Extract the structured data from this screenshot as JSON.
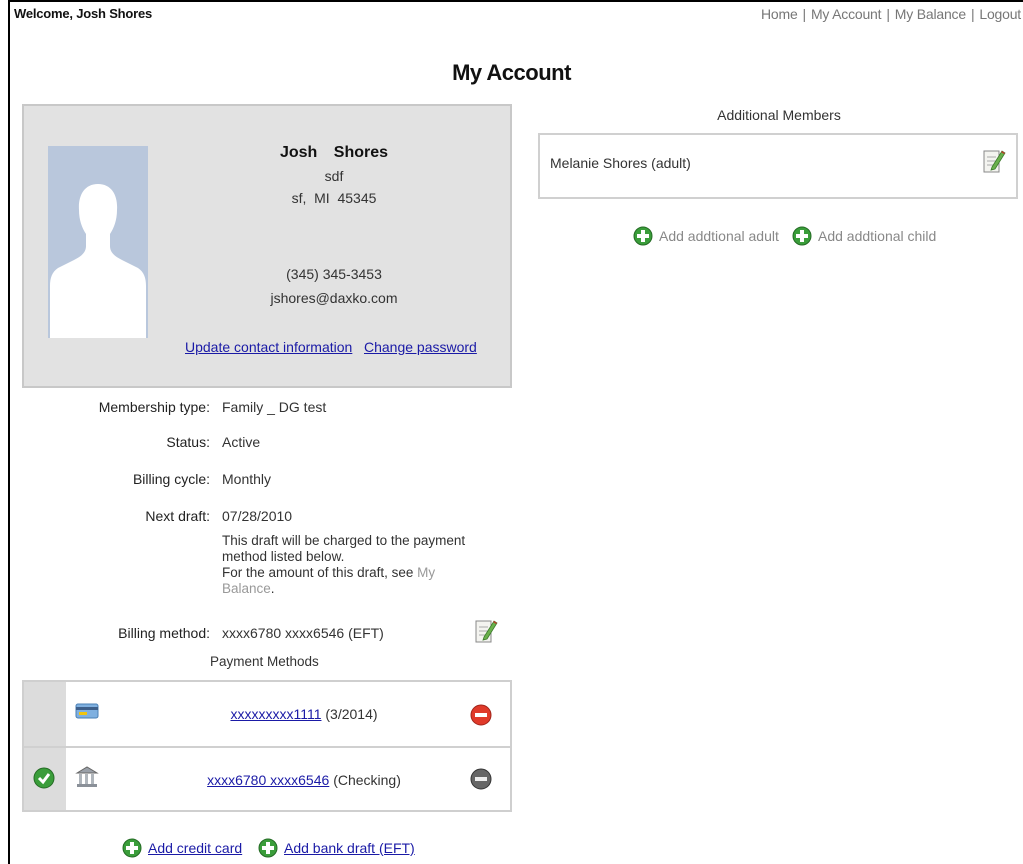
{
  "header": {
    "welcome": "Welcome, Josh Shores",
    "nav": [
      "Home",
      "My Account",
      "My Balance",
      "Logout"
    ]
  },
  "page": {
    "title": "My Account"
  },
  "profile": {
    "first_name": "Josh",
    "last_name": "Shores",
    "name": "Josh Shores",
    "address1": "sdf",
    "city_state_zip": "sf,  MI  45345",
    "phone": "(345) 345-3453",
    "email": "jshores@daxko.com",
    "update_link": "Update contact information",
    "password_link": "Change password"
  },
  "membership": {
    "type_label": "Membership type:",
    "type_value": "Family _ DG test",
    "status_label": "Status:",
    "status_value": "Active",
    "cycle_label": "Billing cycle:",
    "cycle_value": "Monthly",
    "draft_label": "Next draft:",
    "draft_value": "07/28/2010",
    "draft_note_1": "This draft will be charged to the payment method listed below.",
    "draft_note_2": "For the amount of this draft, see",
    "draft_note_link": "My Balance",
    "draft_note_end": ".",
    "billing_label": "Billing method:",
    "billing_value": "xxxx6780 xxxx6546 (EFT)"
  },
  "payment_methods": {
    "title": "Payment Methods",
    "rows": [
      {
        "link": "xxxxxxxxx1111",
        "detail": "(3/2014)",
        "type_icon": "credit-card-icon",
        "action_icon": "remove-icon",
        "default": false
      },
      {
        "link": "xxxx6780 xxxx6546",
        "detail": "(Checking)",
        "type_icon": "bank-icon",
        "action_icon": "remove-disabled-icon",
        "default": true
      }
    ],
    "add_credit": "Add credit card",
    "add_bank": "Add bank draft (EFT)"
  },
  "additional_members": {
    "title": "Additional Members",
    "members": [
      "Melanie Shores (adult)"
    ],
    "add_adult": "Add addtional adult",
    "add_child": "Add addtional child"
  },
  "colors": {
    "link": "#1a1aa6",
    "card_bg": "#e2e2e2",
    "avatar_bg": "#b9c7dc",
    "add_green": "#3a9d3a",
    "remove_red": "#e03a2a"
  }
}
